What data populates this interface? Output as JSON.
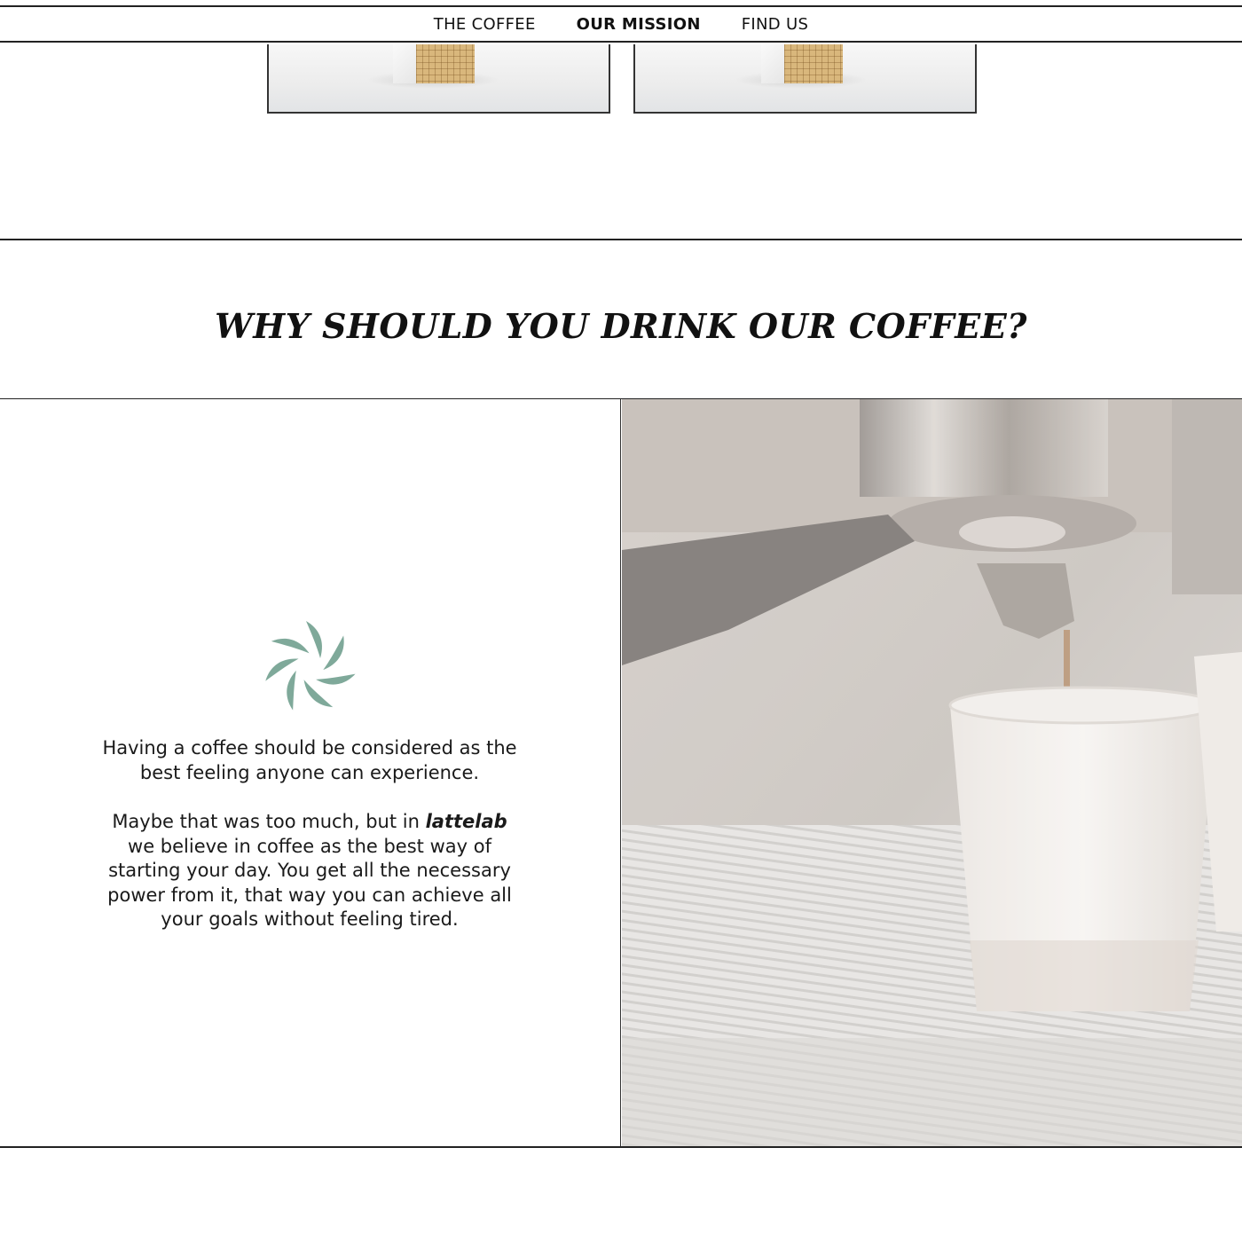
{
  "nav": {
    "items": [
      {
        "label": "THE COFFEE",
        "active": false
      },
      {
        "label": "OUR MISSION",
        "active": true
      },
      {
        "label": "FIND US",
        "active": false
      }
    ]
  },
  "section": {
    "heading": "WHY SHOULD YOU DRINK OUR COFFEE?",
    "paragraph1": "Having a coffee should be considered as the best feeling anyone can experience.",
    "paragraph2_before": "Maybe that was too much, but in ",
    "brand": "lattelab",
    "paragraph2_after": " we believe in coffee as the best way of starting your day. You get all the necessary power from it, that way you can achieve all your goals without feeling tired.",
    "logo_icon": "leaf-swirl-icon",
    "photo_subject": "espresso-machine-pouring-into-paper-cup"
  },
  "colors": {
    "logo": "#7fa99a",
    "text": "#111111",
    "border": "#222222"
  }
}
